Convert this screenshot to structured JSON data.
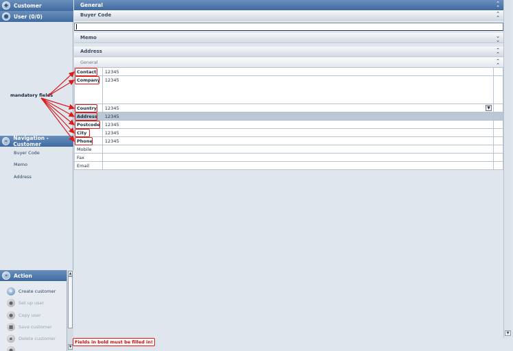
{
  "left": {
    "customer_header": "Customer",
    "user_header": "User (0/0)",
    "nav_header": "Navigation - Customer",
    "nav_links": [
      "Buyer Code",
      "Memo",
      "Address"
    ],
    "action_header": "Action",
    "actions": [
      "Create customer",
      "Set up user",
      "Copy user",
      "Save customer",
      "Delete customer"
    ]
  },
  "main": {
    "general_header": "General",
    "buyer_code_label": "Buyer Code",
    "buyer_code_value": "",
    "memo_label": "Memo",
    "address_label": "Address",
    "address_sub_label": "General"
  },
  "address_fields": [
    {
      "label": "Contact",
      "value": "12345",
      "required": true
    },
    {
      "label": "Company",
      "value": "12345",
      "required": true
    },
    {
      "label": "Country",
      "value": "12345",
      "required": true
    },
    {
      "label": "Address",
      "value": "12345",
      "required": true
    },
    {
      "label": "Postcode",
      "value": "12345",
      "required": true
    },
    {
      "label": "City",
      "value": "12345",
      "required": true
    },
    {
      "label": "Phone",
      "value": "12345",
      "required": true
    },
    {
      "label": "Mobile",
      "value": "",
      "required": false
    },
    {
      "label": "Fax",
      "value": "",
      "required": false
    },
    {
      "label": "Email",
      "value": "",
      "required": false
    }
  ],
  "annotations": {
    "mandatory_label": "mandatory fields",
    "bold_note": "Fields in bold must be filled in!"
  },
  "colors": {
    "header_blue": "#3f6aa0",
    "highlight_red": "#d81d1d",
    "selected_row": "#bac8d6"
  }
}
